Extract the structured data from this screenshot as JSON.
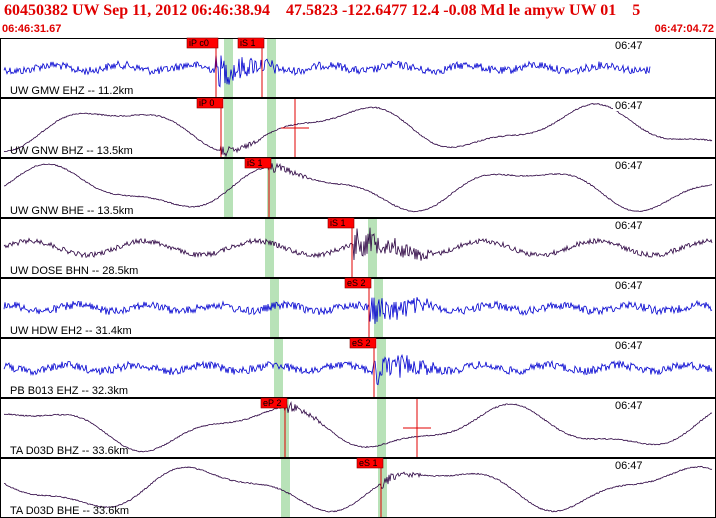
{
  "header": {
    "title": "60450382 UW Sep 11, 2012 06:46:38.94    47.5823 -122.6477 12.4 -0.08 Md le amyw UW 01    5",
    "start_time": "06:46:31.67",
    "end_time": "06:47:04.72"
  },
  "colors": {
    "header_text": "#e00000",
    "pick_flag": "#ff0000",
    "pick_line": "#e00000",
    "travel_time_band": "#9ad69a",
    "trace_blue": "#0000d0",
    "trace_purple": "#2a0040"
  },
  "traces": [
    {
      "label": "UW GMW EHZ -- 11.2km",
      "clock": "06:47",
      "color": "#0000d0",
      "style": "high-freq",
      "picks": [
        {
          "label": "iP c0",
          "t": 0.302
        },
        {
          "label": "iS 1",
          "t": 0.366
        }
      ],
      "band_t": 0.318,
      "band_t2": 0.378
    },
    {
      "label": "UW GNW BHZ -- 13.5km",
      "clock": "06:47",
      "color": "#2a0040",
      "style": "low-freq",
      "picks": [
        {
          "label": "iP 0",
          "t": 0.308
        },
        {
          "label": "",
          "t": 0.412
        }
      ],
      "band_t": 0.318,
      "band_t2": 0.378
    },
    {
      "label": "UW GNW BHE -- 13.5km",
      "clock": "06:47",
      "color": "#2a0040",
      "style": "low-freq",
      "picks": [
        {
          "label": "iS 1",
          "t": 0.376
        }
      ],
      "band_t": 0.318,
      "band_t2": 0.378
    },
    {
      "label": "UW DOSE BHN -- 28.5km",
      "clock": "06:47",
      "color": "#2a0040",
      "style": "mid-freq",
      "picks": [
        {
          "label": "iS 1",
          "t": 0.492
        }
      ],
      "band_t": 0.376,
      "band_t2": 0.52
    },
    {
      "label": "UW HDW EH2 -- 31.4km",
      "clock": "06:47",
      "color": "#0000d0",
      "style": "high-freq",
      "picks": [
        {
          "label": "eS 2",
          "t": 0.516
        }
      ],
      "band_t": 0.382,
      "band_t2": 0.528
    },
    {
      "label": "PB B013 EHZ -- 32.3km",
      "clock": "06:47",
      "color": "#0000d0",
      "style": "high-freq",
      "picks": [
        {
          "label": "eS 2",
          "t": 0.523
        }
      ],
      "band_t": 0.388,
      "band_t2": 0.532
    },
    {
      "label": "TA D03D BHZ -- 33.6km",
      "clock": "06:47",
      "color": "#2a0040",
      "style": "low-freq",
      "picks": [
        {
          "label": "eP 2",
          "t": 0.398
        },
        {
          "label": "",
          "t": 0.583
        }
      ],
      "band_t": 0.396,
      "band_t2": 0.532
    },
    {
      "label": "TA D03D BHE -- 33.6km",
      "clock": "06:47",
      "color": "#2a0040",
      "style": "low-freq",
      "picks": [
        {
          "label": "eS 1",
          "t": 0.532
        }
      ],
      "band_t": 0.398,
      "band_t2": 0.534
    }
  ]
}
